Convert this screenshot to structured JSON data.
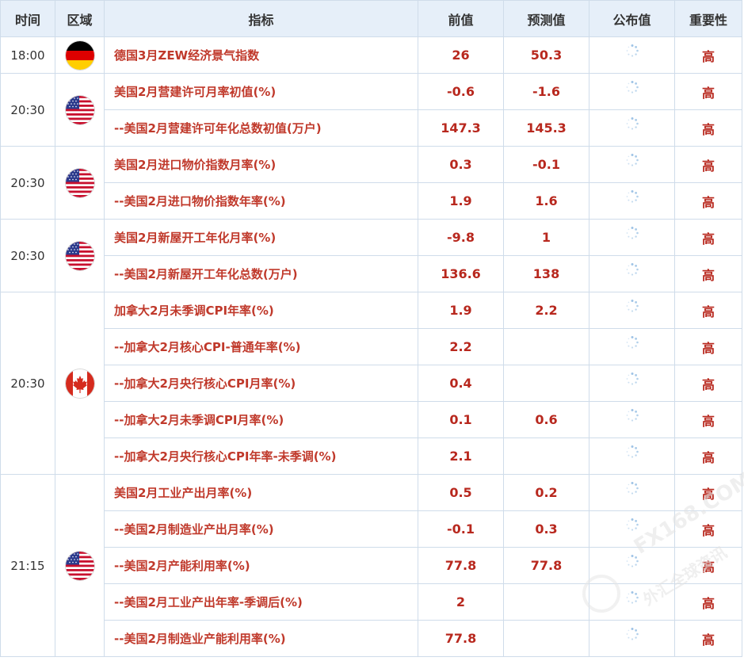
{
  "headers": {
    "time": "时间",
    "region": "区域",
    "indicator": "指标",
    "previous": "前值",
    "forecast": "预测值",
    "actual": "公布值",
    "importance": "重要性"
  },
  "groups": [
    {
      "time": "18:00",
      "region": "germany",
      "flag_icon": "germany-flag-icon",
      "rowspan": 1
    },
    {
      "time": "20:30",
      "region": "usa",
      "flag_icon": "usa-flag-icon",
      "rowspan": 2
    },
    {
      "time": "20:30",
      "region": "usa",
      "flag_icon": "usa-flag-icon",
      "rowspan": 2
    },
    {
      "time": "20:30",
      "region": "usa",
      "flag_icon": "usa-flag-icon",
      "rowspan": 2
    },
    {
      "time": "20:30",
      "region": "canada",
      "flag_icon": "canada-flag-icon",
      "rowspan": 5
    },
    {
      "time": "21:15",
      "region": "usa",
      "flag_icon": "usa-flag-icon",
      "rowspan": 5
    }
  ],
  "rows": [
    {
      "indicator": "德国3月ZEW经济景气指数",
      "previous": "26",
      "forecast": "50.3",
      "importance": "高"
    },
    {
      "indicator": "美国2月营建许可月率初值(%)",
      "previous": "-0.6",
      "forecast": "-1.6",
      "importance": "高"
    },
    {
      "indicator": "--美国2月营建许可年化总数初值(万户)",
      "previous": "147.3",
      "forecast": "145.3",
      "importance": "高"
    },
    {
      "indicator": "美国2月进口物价指数月率(%)",
      "previous": "0.3",
      "forecast": "-0.1",
      "importance": "高"
    },
    {
      "indicator": "--美国2月进口物价指数年率(%)",
      "previous": "1.9",
      "forecast": "1.6",
      "importance": "高"
    },
    {
      "indicator": "美国2月新屋开工年化月率(%)",
      "previous": "-9.8",
      "forecast": "1",
      "importance": "高"
    },
    {
      "indicator": "--美国2月新屋开工年化总数(万户)",
      "previous": "136.6",
      "forecast": "138",
      "importance": "高"
    },
    {
      "indicator": "加拿大2月未季调CPI年率(%)",
      "previous": "1.9",
      "forecast": "2.2",
      "importance": "高"
    },
    {
      "indicator": "--加拿大2月核心CPI-普通年率(%)",
      "previous": "2.2",
      "forecast": "",
      "importance": "高"
    },
    {
      "indicator": "--加拿大2月央行核心CPI月率(%)",
      "previous": "0.4",
      "forecast": "",
      "importance": "高"
    },
    {
      "indicator": "--加拿大2月未季调CPI月率(%)",
      "previous": "0.1",
      "forecast": "0.6",
      "importance": "高"
    },
    {
      "indicator": "--加拿大2月央行核心CPI年率-未季调(%)",
      "previous": "2.1",
      "forecast": "",
      "importance": "高"
    },
    {
      "indicator": "美国2月工业产出月率(%)",
      "previous": "0.5",
      "forecast": "0.2",
      "importance": "高"
    },
    {
      "indicator": "--美国2月制造业产出月率(%)",
      "previous": "-0.1",
      "forecast": "0.3",
      "importance": "高"
    },
    {
      "indicator": "--美国2月产能利用率(%)",
      "previous": "77.8",
      "forecast": "77.8",
      "importance": "高"
    },
    {
      "indicator": "--美国2月工业产出年率-季调后(%)",
      "previous": "2",
      "forecast": "",
      "importance": "高"
    },
    {
      "indicator": "--美国2月制造业产能利用率(%)",
      "previous": "77.8",
      "forecast": "",
      "importance": "高"
    }
  ],
  "actual_placeholder_icon": "loading-spinner-icon",
  "watermark": {
    "line1": "FX168.COM",
    "line2": "外汇全球资讯"
  },
  "colors": {
    "header_bg": "#e6eff9",
    "border": "#cfdcea",
    "indicator_text": "#c0392b",
    "value_text": "#b8281e"
  }
}
